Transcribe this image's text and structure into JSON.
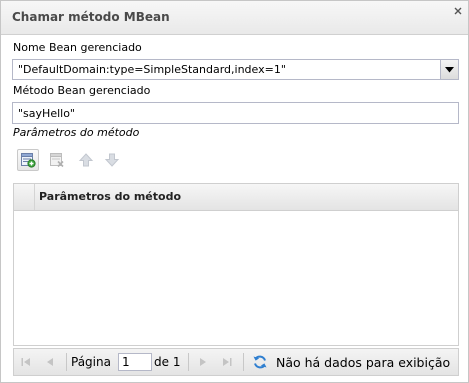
{
  "panel": {
    "title": "Chamar método MBean",
    "close_icon": "close-icon"
  },
  "bean_field": {
    "label": "Nome Bean gerenciado",
    "value": "\"DefaultDomain:type=SimpleStandard,index=1\"",
    "trigger_icon": "dropdown-arrow-icon"
  },
  "method_field": {
    "label": "Método Bean gerenciado",
    "value": "\"sayHello\""
  },
  "params_section": {
    "label": "Parâmetros do método"
  },
  "toolbar": {
    "buttons": [
      {
        "icon": "add-parameter-icon",
        "enabled": true
      },
      {
        "icon": "delete-parameter-icon",
        "enabled": false
      },
      {
        "icon": "move-up-icon",
        "enabled": false
      },
      {
        "icon": "move-down-icon",
        "enabled": false
      }
    ]
  },
  "grid": {
    "columns": [
      "Parâmetros do método"
    ],
    "rows": []
  },
  "pager": {
    "page_label": "Página",
    "page_value": "1",
    "of_label": "de 1",
    "empty_message": "Não há dados para exibição",
    "icons": [
      "first-page-icon",
      "prev-page-icon",
      "next-page-icon",
      "last-page-icon",
      "refresh-icon"
    ]
  }
}
